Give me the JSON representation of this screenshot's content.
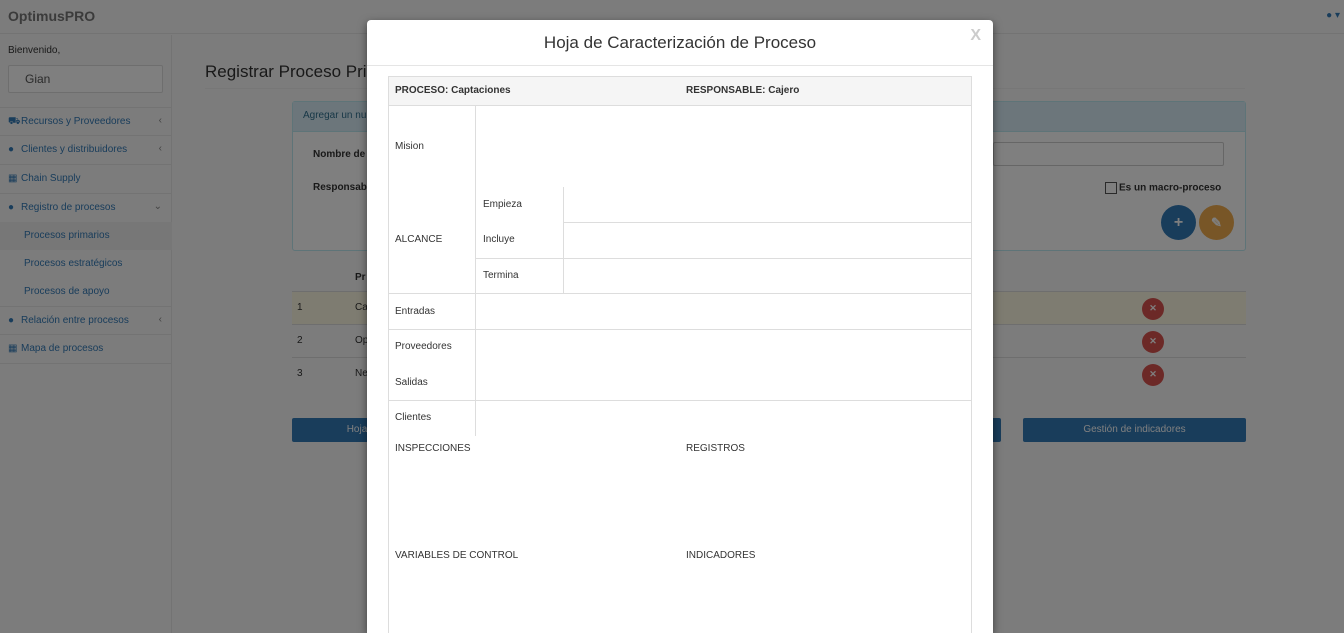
{
  "navbar": {
    "brand": "OptimusPRO",
    "user_icon": "user-icon"
  },
  "sidebar": {
    "welcome": "Bienvenido,",
    "user": "Gian",
    "items": [
      {
        "label": "Recursos y Proveedores",
        "icon": "truck-icon",
        "has_children": true
      },
      {
        "label": "Clientes y distribuidores",
        "icon": "users-icon",
        "has_children": true
      },
      {
        "label": "Chain Supply",
        "icon": "sitemap-icon",
        "has_children": false
      },
      {
        "label": "Registro de procesos",
        "icon": "users-icon",
        "has_children": true,
        "expanded": true
      },
      {
        "label": "Relación entre procesos",
        "icon": "users-icon",
        "has_children": true
      },
      {
        "label": "Mapa de procesos",
        "icon": "sitemap-icon",
        "has_children": false
      }
    ],
    "subitems": [
      {
        "label": "Procesos primarios",
        "active": true
      },
      {
        "label": "Procesos estratégicos",
        "active": false
      },
      {
        "label": "Procesos de apoyo",
        "active": false
      }
    ]
  },
  "main": {
    "title": "Registrar Proceso Pri",
    "panel_heading": "Agregar un nu",
    "label_nombre": "Nombre de",
    "label_responsable": "Responsab",
    "macro_label": "Es un macro-proceso",
    "table_header": "Pr",
    "rows": [
      {
        "num": "1",
        "text": "Ca"
      },
      {
        "num": "2",
        "text": "Op"
      },
      {
        "num": "3",
        "text": "Ne"
      }
    ],
    "btn_hoja": "Hoja",
    "btn_indicadores": "Gestión de indicadores"
  },
  "modal": {
    "title": "Hoja de Caracterización de Proceso",
    "close": "X",
    "proceso": "PROCESO: Captaciones",
    "responsable": "RESPONSABLE: Cajero",
    "mision": "Mision",
    "alcance": "ALCANCE",
    "empieza": "Empieza",
    "incluye": "Incluye",
    "termina": "Termina",
    "entradas": "Entradas",
    "proveedores": "Proveedores",
    "salidas": "Salidas",
    "clientes": "Clientes",
    "inspecciones": "INSPECCIONES",
    "registros": "REGISTROS",
    "variables": "VARIABLES DE CONTROL",
    "indicadores": "INDICADORES"
  },
  "colors": {
    "primary": "#337ab7",
    "danger": "#d9534f",
    "warning": "#f0ad4e",
    "info_bg": "#d9edf7"
  }
}
